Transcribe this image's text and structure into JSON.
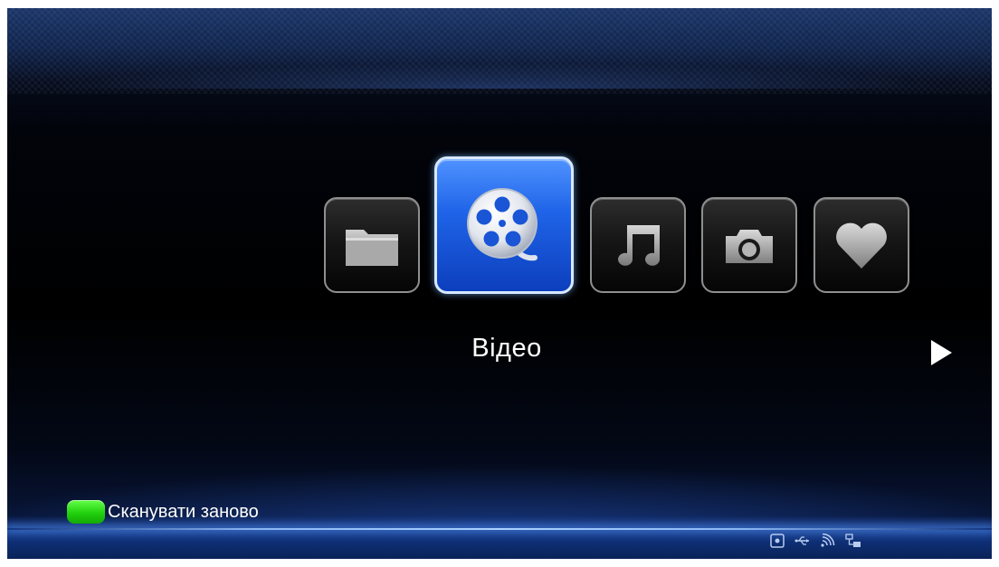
{
  "menu": {
    "items": [
      {
        "id": "files",
        "icon": "folder-icon",
        "selected": false
      },
      {
        "id": "video",
        "icon": "film-reel-icon",
        "selected": true,
        "label": "Відео"
      },
      {
        "id": "music",
        "icon": "music-note-icon",
        "selected": false
      },
      {
        "id": "photo",
        "icon": "camera-icon",
        "selected": false
      },
      {
        "id": "favorites",
        "icon": "heart-icon",
        "selected": false
      }
    ],
    "selected_label": "Відео",
    "next_icon": "play-arrow-icon"
  },
  "hint": {
    "key_color": "#22d10e",
    "label": "Сканувати заново"
  },
  "status_bar": {
    "icons": [
      "disk-icon",
      "usb-icon",
      "wifi-icon",
      "network-icon"
    ]
  },
  "colors": {
    "accent": "#1f64e8",
    "background": "#000000",
    "band": "#143a8a"
  }
}
